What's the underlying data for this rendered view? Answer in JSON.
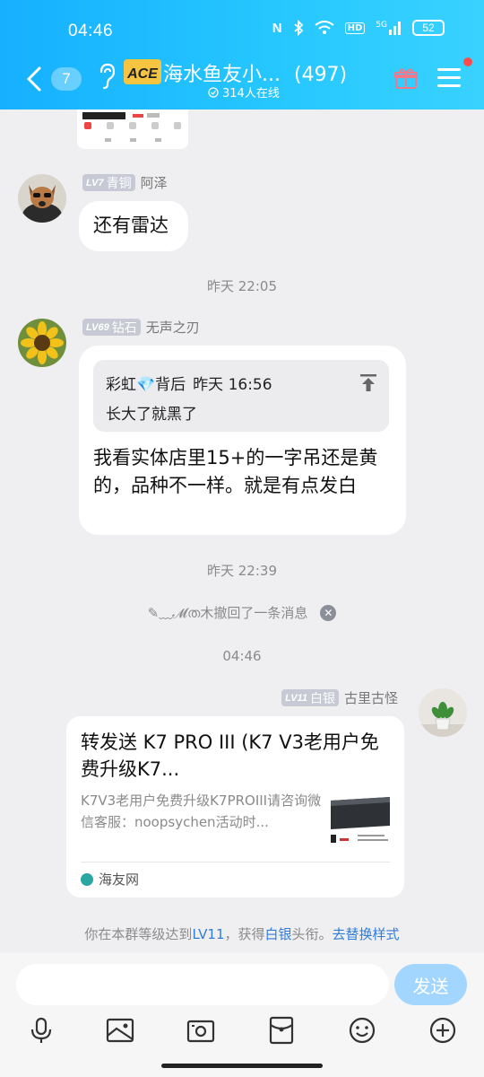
{
  "status_bar": {
    "time": "04:46",
    "nfc": "N",
    "hd": "HD",
    "signal_label": "5G",
    "battery": "52"
  },
  "header": {
    "unread_count": "7",
    "group_title": "海水鱼友小...",
    "member_count": "(497)",
    "online_text": "314人在线",
    "logo_text": "ACE",
    "accent_color": "#1eb8ff"
  },
  "messages": {
    "msg1": {
      "level": "LV7",
      "rank": "青铜",
      "sender": "阿泽",
      "text": "还有雷达"
    },
    "time1": "昨天 22:05",
    "msg2": {
      "level": "LV69",
      "rank": "钻石",
      "sender": "无声之刃",
      "quote_author": "彩虹💎背后",
      "quote_time": "昨天 16:56",
      "quote_text": "长大了就黑了",
      "text": "我看实体店里15+的一字吊还是黄的，品种不一样。就是有点发白"
    },
    "time2": "昨天 22:39",
    "recall": {
      "user": "✎﹏𝓜ത木",
      "text": "撤回了一条消息"
    },
    "time3": "04:46",
    "msg3": {
      "level": "LV11",
      "rank": "白银",
      "sender": "古里古怪",
      "card_title": "转发送 K7 PRO III (K7 V3老用户免费升级K7...",
      "card_desc": "K7V3老用户免费升级K7PROIII请咨询微信客服：noopsychen活动时...",
      "card_source": "海友网"
    },
    "system": {
      "prefix": "你在本群等级达到",
      "level": "LV11",
      "mid": "，获得",
      "title": "白银",
      "suffix": "头衔。",
      "action": "去替换样式"
    }
  },
  "input_bar": {
    "placeholder": "",
    "send_label": "发送"
  }
}
